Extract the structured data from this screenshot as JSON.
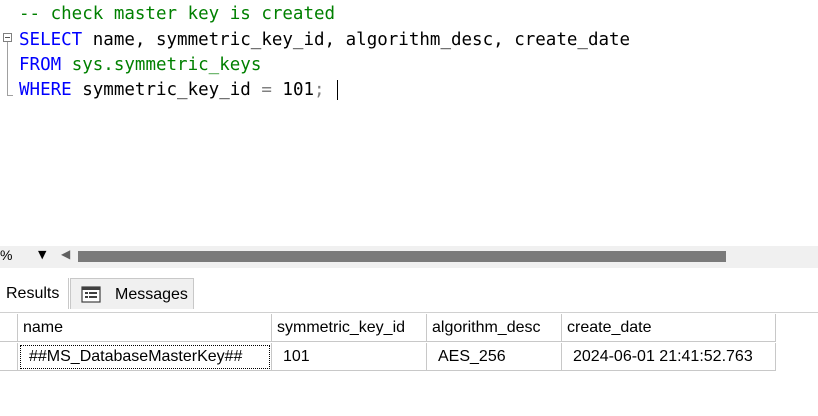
{
  "editor": {
    "comment": "-- check master key is created",
    "line2": {
      "select_kw": "SELECT",
      "columns": " name, symmetric_key_id, algorithm_desc, create_date"
    },
    "line3": {
      "from_kw": "FROM",
      "table": "sys.symmetric_keys"
    },
    "line4": {
      "where_kw": "WHERE",
      "condition_col": " symmetric_key_id ",
      "equals": "=",
      "value": " 101",
      "semicolon": ";"
    }
  },
  "status_strip": {
    "zoom": "%"
  },
  "tabs": [
    {
      "label": "Results"
    },
    {
      "label": "Messages"
    }
  ],
  "results": {
    "columns": [
      "name",
      "symmetric_key_id",
      "algorithm_desc",
      "create_date"
    ],
    "rows": [
      [
        "##MS_DatabaseMasterKey##",
        "101",
        "AES_256",
        "2024-06-01 21:41:52.763"
      ]
    ]
  },
  "colors": {
    "keyword": "#0000ff",
    "comment": "#008000",
    "system_object": "#008000",
    "operator": "#808080"
  },
  "icons": {
    "messages_tab": "messages-icon",
    "fold_toggle": "collapse-icon",
    "zoom_dropdown": "dropdown-arrow-icon",
    "scroll_left": "scroll-left-icon"
  }
}
